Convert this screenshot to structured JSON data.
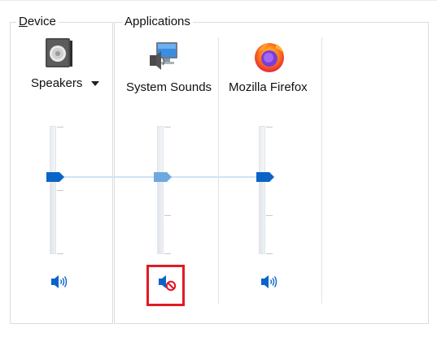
{
  "device": {
    "group_title": "Device",
    "mnemonic": "D",
    "title_rest": "evice",
    "icon": "speaker-device-icon",
    "name": "Speakers",
    "volume_percent": 59,
    "muted": false
  },
  "applications": {
    "group_title": "Applications",
    "items": [
      {
        "name": "System Sounds",
        "icon": "system-sounds-icon",
        "volume_percent": 59,
        "muted": true,
        "highlighted": true
      },
      {
        "name": "Mozilla Firefox",
        "icon": "firefox-icon",
        "volume_percent": 59,
        "muted": false,
        "highlighted": false
      }
    ]
  },
  "colors": {
    "accent": "#0a64c8",
    "highlight": "#e01b24",
    "mute_badge": "#e81123"
  }
}
